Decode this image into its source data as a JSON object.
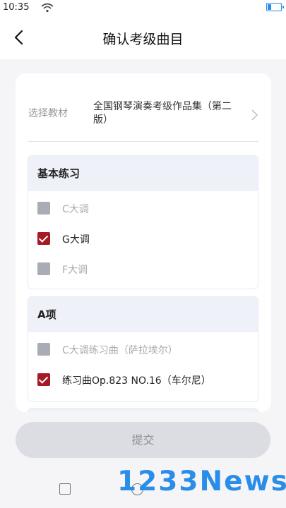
{
  "status": {
    "time": "10:35"
  },
  "nav": {
    "title": "确认考级曲目"
  },
  "textbook": {
    "label": "选择教材",
    "value": "全国钢琴演奏考级作品集（第二版）"
  },
  "sections": [
    {
      "title": "基本练习",
      "items": [
        {
          "label": "C大调",
          "checked": false
        },
        {
          "label": "G大调",
          "checked": true
        },
        {
          "label": "F大调",
          "checked": false
        }
      ]
    },
    {
      "title": "A项",
      "items": [
        {
          "label": "C大调练习曲（萨拉埃尔）",
          "checked": false
        },
        {
          "label": "练习曲Op.823  NO.16（车尔尼）",
          "checked": true
        }
      ]
    }
  ],
  "actions": {
    "submit_label": "提交"
  },
  "watermark": {
    "text": "1233News"
  },
  "colors": {
    "accent_checked": "#a51a24",
    "section_header_bg": "#eef1f8",
    "watermark": "#2a8ee8"
  }
}
